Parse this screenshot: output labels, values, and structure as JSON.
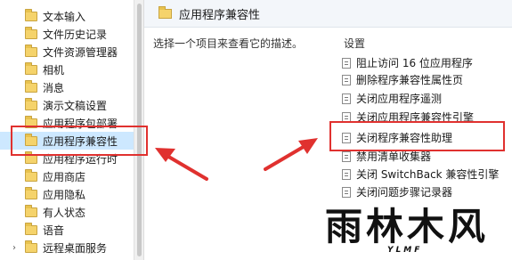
{
  "tree": {
    "items": [
      {
        "label": "文本输入",
        "expander": ""
      },
      {
        "label": "文件历史记录",
        "expander": ""
      },
      {
        "label": "文件资源管理器",
        "expander": ""
      },
      {
        "label": "相机",
        "expander": ""
      },
      {
        "label": "消息",
        "expander": ""
      },
      {
        "label": "演示文稿设置",
        "expander": ""
      },
      {
        "label": "应用程序包部署",
        "expander": ""
      },
      {
        "label": "应用程序兼容性",
        "expander": "",
        "selected": true
      },
      {
        "label": "应用程序运行时",
        "expander": ""
      },
      {
        "label": "应用商店",
        "expander": ""
      },
      {
        "label": "应用隐私",
        "expander": ""
      },
      {
        "label": "有人状态",
        "expander": ""
      },
      {
        "label": "语音",
        "expander": ""
      },
      {
        "label": "远程桌面服务",
        "expander": "›"
      }
    ]
  },
  "pane": {
    "title": "应用程序兼容性",
    "description": "选择一个项目来查看它的描述。",
    "settings_header": "设置",
    "settings": [
      "阻止访问 16 位应用程序",
      "删除程序兼容性属性页",
      "关闭应用程序遥测",
      "关闭应用程序兼容性引擎",
      "关闭程序兼容性助理",
      "禁用清单收集器",
      "关闭 SwitchBack 兼容性引擎",
      "关闭问题步骤记录器"
    ]
  },
  "annotation_color": "#e0312f",
  "watermark": {
    "main": "雨林木风",
    "sub": "YLMF"
  }
}
